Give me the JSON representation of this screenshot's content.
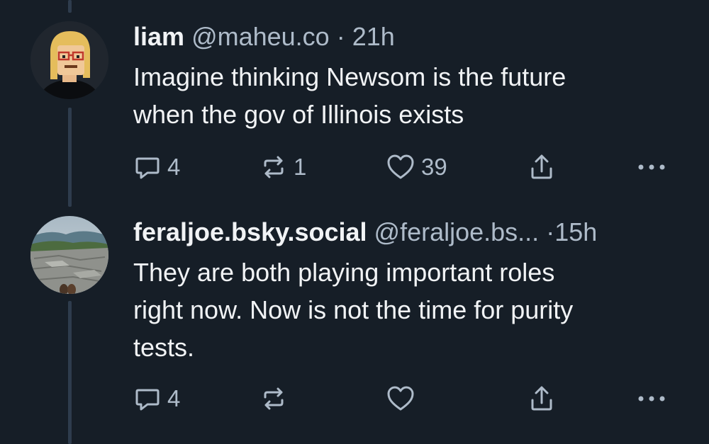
{
  "posts": [
    {
      "name": "liam",
      "handle": "@maheu.co",
      "separator": "·",
      "time": "21h",
      "text_lines": [
        "Imagine thinking Newsom is the future",
        "when the gov of Illinois exists"
      ],
      "reply_count": "4",
      "repost_count": "1",
      "like_count": "39"
    },
    {
      "name": "feraljoe.bsky.social",
      "handle": "@feraljoe.bs...",
      "separator": "·",
      "time": "15h",
      "text_lines": [
        "They are both playing important roles",
        "right now. Now is not the time for purity",
        "tests."
      ],
      "reply_count": "4",
      "repost_count": "",
      "like_count": ""
    }
  ],
  "colors": {
    "background": "#161e27",
    "text_primary": "#f1f3f5",
    "text_secondary": "#aebbc9",
    "thread_line": "#2e3c4d"
  },
  "icons": [
    "reply-icon",
    "repost-icon",
    "like-icon",
    "share-icon",
    "more-options-icon"
  ]
}
